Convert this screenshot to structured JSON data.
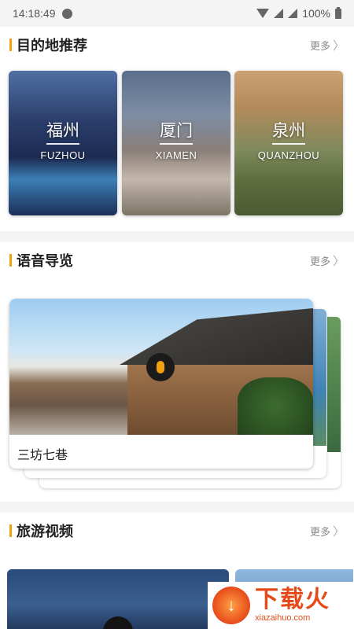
{
  "status_bar": {
    "time": "14:18:49",
    "battery": "100%"
  },
  "sections": {
    "destinations": {
      "title": "目的地推荐",
      "more": "更多",
      "items": [
        {
          "name": "福州",
          "en": "FUZHOU"
        },
        {
          "name": "厦门",
          "en": "XIAMEN"
        },
        {
          "name": "泉州",
          "en": "QUANZHOU"
        }
      ]
    },
    "audio_guide": {
      "title": "语音导览",
      "more": "更多",
      "card_label": "三坊七巷"
    },
    "travel_video": {
      "title": "旅游视频",
      "more": "更多"
    }
  },
  "watermark": {
    "title": "下载火",
    "url": "xiazaihuo.com"
  },
  "colors": {
    "accent": "#f2a20f",
    "watermark": "#e64a19"
  }
}
